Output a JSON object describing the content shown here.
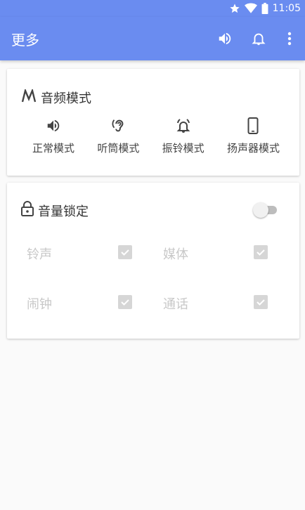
{
  "status_bar": {
    "time": "11:05",
    "icons": [
      "star-icon",
      "wifi-icon",
      "battery-icon"
    ]
  },
  "app_bar": {
    "title": "更多",
    "actions": [
      "volume-icon",
      "bell-icon",
      "more-vert-icon"
    ]
  },
  "audio_mode_card": {
    "title": "音频模式",
    "title_icon": "mode-m-icon",
    "modes": [
      {
        "label": "正常模式",
        "icon": "speaker-icon"
      },
      {
        "label": "听筒模式",
        "icon": "ear-icon"
      },
      {
        "label": "振铃模式",
        "icon": "ringing-bell-icon"
      },
      {
        "label": "扬声器模式",
        "icon": "phone-icon"
      }
    ]
  },
  "volume_lock_card": {
    "title": "音量锁定",
    "title_icon": "lock-icon",
    "toggle_on": false,
    "items": [
      {
        "label": "铃声",
        "checked": true
      },
      {
        "label": "媒体",
        "checked": true
      },
      {
        "label": "闹钟",
        "checked": true
      },
      {
        "label": "通话",
        "checked": true
      }
    ]
  },
  "colors": {
    "primary": "#6a8cf0",
    "disabled_text": "#c8c8c8",
    "card": "#ffffff",
    "background": "#fafafa"
  }
}
